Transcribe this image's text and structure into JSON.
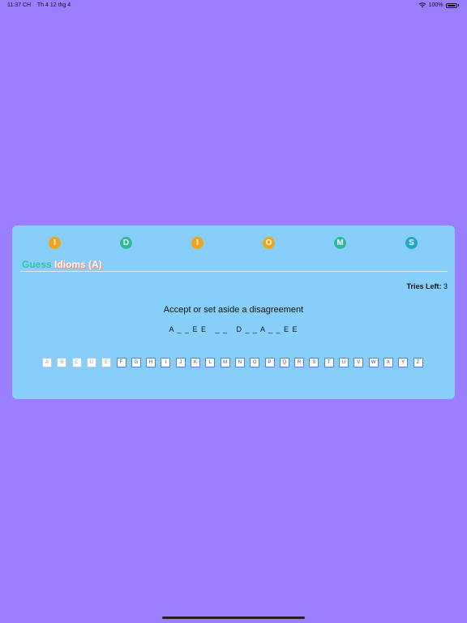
{
  "status_bar": {
    "time": "11:37 CH",
    "date": "Th 4 12 thg 4",
    "battery": "100%"
  },
  "logo": [
    {
      "letter": "I",
      "color": "#f0a419"
    },
    {
      "letter": "D",
      "color": "#2fb89a"
    },
    {
      "letter": "I",
      "color": "#f0a419"
    },
    {
      "letter": "O",
      "color": "#f0a419"
    },
    {
      "letter": "M",
      "color": "#2fb89a"
    },
    {
      "letter": "S",
      "color": "#1fa8c8"
    }
  ],
  "title": {
    "guess": "Guess",
    "idioms": "Idioms (A)"
  },
  "tries": {
    "label": "Tries Left:",
    "value": "3"
  },
  "clue": "Accept or set aside a disagreement",
  "masked_answer": "A _ _ E E   _ _   D _ _ A _ _ E E",
  "keyboard": {
    "keys": [
      "A",
      "B",
      "C",
      "D",
      "E",
      "F",
      "G",
      "H",
      "I",
      "J",
      "K",
      "L",
      "M",
      "N",
      "O",
      "P",
      "Q",
      "R",
      "S",
      "T",
      "U",
      "V",
      "W",
      "X",
      "Y",
      "Z"
    ],
    "used": [
      "A",
      "B",
      "C",
      "D",
      "E"
    ]
  }
}
